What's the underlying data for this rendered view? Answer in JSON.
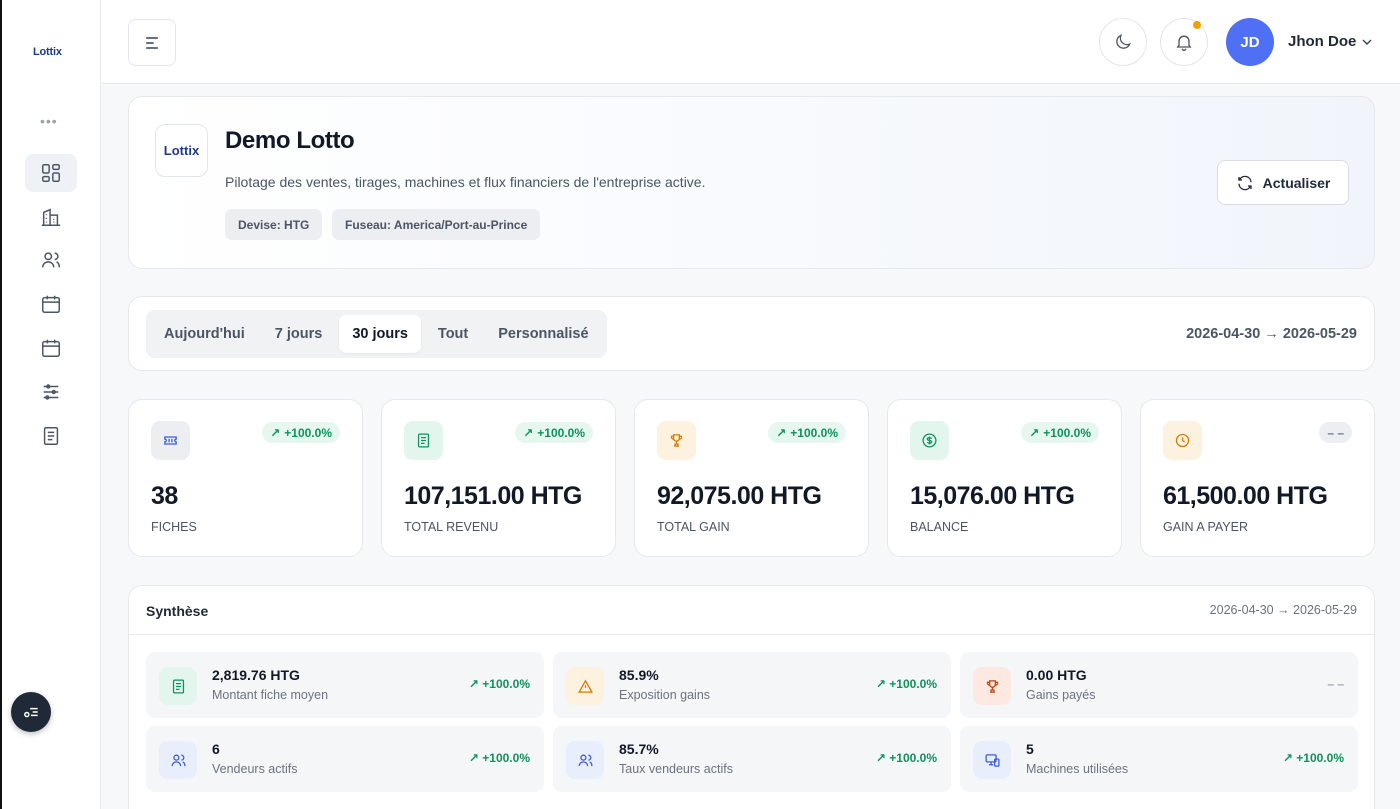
{
  "sidebar": {
    "logo_text": "Lottix",
    "more_label": "•••"
  },
  "header": {
    "user": {
      "initials": "JD",
      "name": "Jhon Doe"
    }
  },
  "company": {
    "logo_text": "Lottix",
    "name": "Demo Lotto",
    "description": "Pilotage des ventes, tirages, machines et flux financiers de l'entreprise active.",
    "chips": [
      "Devise: HTG",
      "Fuseau: America/Port-au-Prince"
    ],
    "refresh_label": "Actualiser"
  },
  "period": {
    "tabs": [
      "Aujourd'hui",
      "7 jours",
      "30 jours",
      "Tout",
      "Personnalisé"
    ],
    "active_tab": "30 jours",
    "range": "2026-04-30 → 2026-05-29"
  },
  "stats": [
    {
      "value": "38",
      "label": "FICHES",
      "delta": "+100.0%",
      "trend": "up",
      "icon": "ticket-icon",
      "tone": "grey"
    },
    {
      "value": "107,151.00 HTG",
      "label": "TOTAL REVENU",
      "delta": "+100.0%",
      "trend": "up",
      "icon": "receipt-icon",
      "tone": "green"
    },
    {
      "value": "92,075.00 HTG",
      "label": "TOTAL GAIN",
      "delta": "+100.0%",
      "trend": "up",
      "icon": "trophy-icon",
      "tone": "orange"
    },
    {
      "value": "15,076.00 HTG",
      "label": "BALANCE",
      "delta": "+100.0%",
      "trend": "up",
      "icon": "dollar-icon",
      "tone": "green"
    },
    {
      "value": "61,500.00 HTG",
      "label": "GAIN A PAYER",
      "delta": "– –",
      "trend": "neutral",
      "icon": "clock-icon",
      "tone": "orange"
    }
  ],
  "synthesis": {
    "title": "Synthèse",
    "range": "2026-04-30 → 2026-05-29",
    "metrics": [
      {
        "value": "2,819.76 HTG",
        "label": "Montant fiche moyen",
        "delta": "↗ +100.0%",
        "trend": "up",
        "icon": "receipt-icon",
        "tone": "green"
      },
      {
        "value": "85.9%",
        "label": "Exposition gains",
        "delta": "↗ +100.0%",
        "trend": "up",
        "icon": "warning-icon",
        "tone": "orange"
      },
      {
        "value": "0.00 HTG",
        "label": "Gains payés",
        "delta": "– –",
        "trend": "neutral",
        "icon": "trophy-icon",
        "tone": "red"
      },
      {
        "value": "6",
        "label": "Vendeurs actifs",
        "delta": "↗ +100.0%",
        "trend": "up",
        "icon": "users-icon",
        "tone": "blue"
      },
      {
        "value": "85.7%",
        "label": "Taux vendeurs actifs",
        "delta": "↗ +100.0%",
        "trend": "up",
        "icon": "users-icon",
        "tone": "blue"
      },
      {
        "value": "5",
        "label": "Machines utilisées",
        "delta": "↗ +100.0%",
        "trend": "up",
        "icon": "devices-icon",
        "tone": "blue"
      }
    ]
  },
  "colors": {
    "accent": "#4f6ff5",
    "positive": "#10915b",
    "warning_dot": "#f59e0b"
  }
}
